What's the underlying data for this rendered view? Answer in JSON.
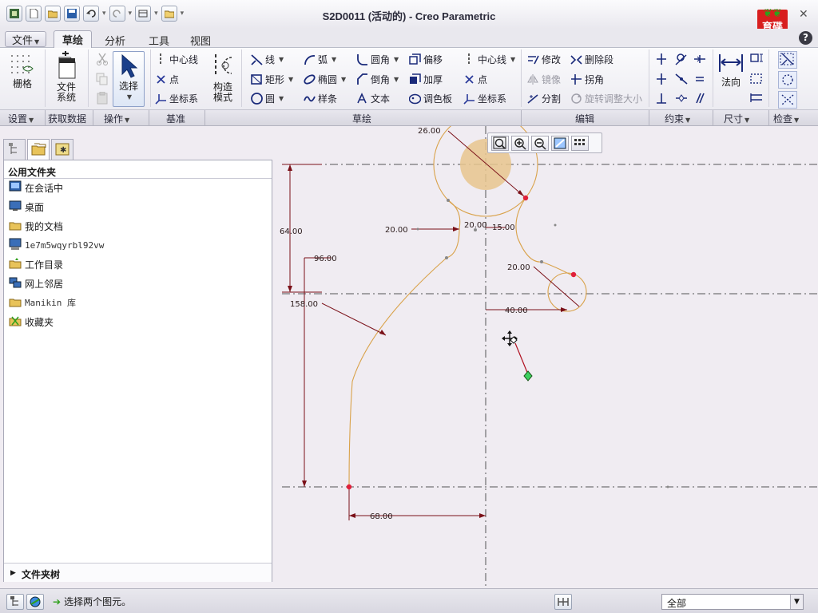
{
  "window": {
    "title": "S2D0011 (活动的) - Creo Parametric"
  },
  "brand": {
    "text": "育碟软件",
    "leaf": "❦❦"
  },
  "menu": {
    "file_label": "文件",
    "tabs": [
      "草绘",
      "分析",
      "工具",
      "视图"
    ]
  },
  "ribbon": {
    "setup": {
      "grid_label": "栅格"
    },
    "data": {
      "file_system_label": "文件系统"
    },
    "operations": {
      "select_label": "选择"
    },
    "datum": {
      "centerline": "中心线",
      "point": "点",
      "coord_sys": "坐标系",
      "construction_mode": "构造模式"
    },
    "sketch": {
      "line": "线",
      "arc": "弧",
      "fillet": "圆角",
      "offset": "偏移",
      "rectangle": "矩形",
      "ellipse": "椭圆",
      "chamfer": "倒角",
      "thicken": "加厚",
      "circle": "圆",
      "spline": "样条",
      "text": "文本",
      "palette": "调色板",
      "centerline": "中心线",
      "point": "点",
      "coord_sys": "坐标系"
    },
    "edit": {
      "modify": "修改",
      "delete_segment": "删除段",
      "mirror": "镜像",
      "corner": "拐角",
      "divide": "分割",
      "rotate_resize": "旋转调整大小"
    },
    "constrain": {
      "normal_label": "法向"
    }
  },
  "groups": {
    "setup": "设置",
    "get_data": "获取数据",
    "operations": "操作",
    "datum": "基准",
    "sketch": "草绘",
    "edit": "编辑",
    "constrain": "约束",
    "dimension": "尺寸",
    "inspect": "检查"
  },
  "navigator": {
    "header": "公用文件夹",
    "items": [
      {
        "label": "在会话中",
        "icon": "session-icon"
      },
      {
        "label": "桌面",
        "icon": "desktop-icon"
      },
      {
        "label": "我的文档",
        "icon": "documents-icon"
      },
      {
        "label": "1e7m5wqyrbl92vw",
        "icon": "computer-icon"
      },
      {
        "label": "工作目录",
        "icon": "working-dir-icon"
      },
      {
        "label": "网上邻居",
        "icon": "network-icon"
      },
      {
        "label": "Manikin 库",
        "icon": "library-icon"
      },
      {
        "label": "收藏夹",
        "icon": "favorites-icon"
      }
    ],
    "folder_tree_label": "文件夹树"
  },
  "sketch": {
    "dimensions": {
      "d26": "26.00",
      "d64": "64.00",
      "d96": "96.00",
      "d158": "158.00",
      "d20a": "20.00",
      "d20b": "20.00",
      "d15": "15.00",
      "d20c": "20.00",
      "d40": "40.00",
      "d68": "68.00"
    }
  },
  "statusbar": {
    "message": "选择两个图元。",
    "filter_value": "全部"
  },
  "colors": {
    "sketch_line": "#d9a24a",
    "dimension": "#7a1018",
    "vertex": "#e0203a",
    "centerline": "#555555",
    "fill": "#e8c58e"
  }
}
